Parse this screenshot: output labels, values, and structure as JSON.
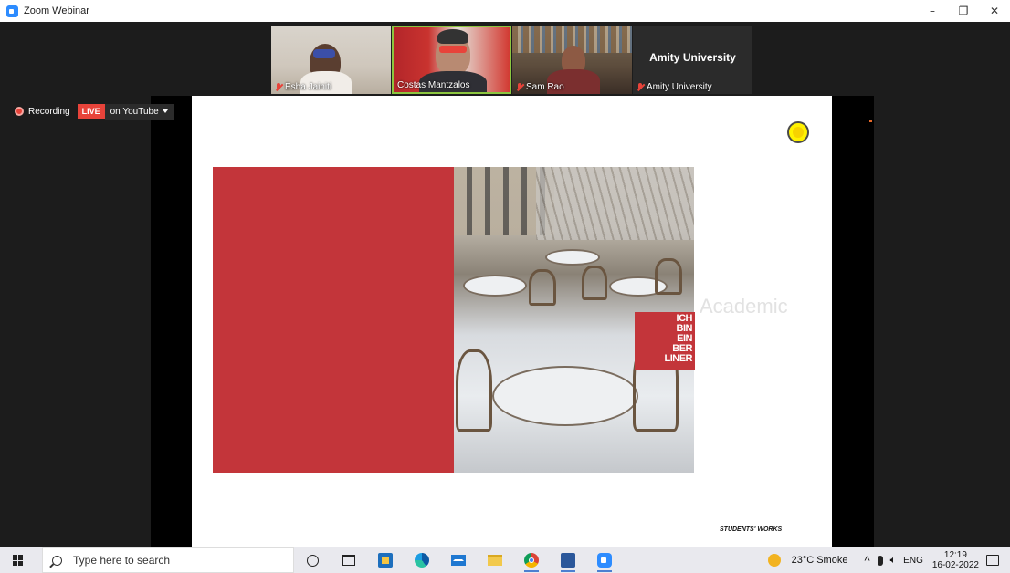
{
  "window": {
    "title": "Zoom Webinar",
    "controls": [
      "–",
      "❐",
      "✕"
    ]
  },
  "participants": [
    {
      "name": "Esha Jainiti",
      "muted": true
    },
    {
      "name": "Costas Mantzalos",
      "muted": false,
      "active_speaker": true
    },
    {
      "name": "Sam Rao",
      "muted": true
    },
    {
      "name": "Amity University",
      "muted": true,
      "video_off": true
    }
  ],
  "recording": {
    "label": "Recording",
    "live_badge": "LIVE",
    "stream_target": "on YouTube"
  },
  "slide": {
    "overlay_text": [
      "ICH",
      "BIN",
      "EIN",
      "BER",
      "LINER"
    ],
    "watermark": "Academic",
    "footer": "STUDENTS' WORKS"
  },
  "taskbar": {
    "search_placeholder": "Type here to search",
    "weather": "23°C  Smoke",
    "language": "ENG",
    "time": "12:19",
    "date": "16-02-2022"
  },
  "colors": {
    "zoom_blue": "#2d8cff",
    "slide_red": "#c3353a",
    "live_red": "#e8433a",
    "active_border": "#8cc63f"
  }
}
